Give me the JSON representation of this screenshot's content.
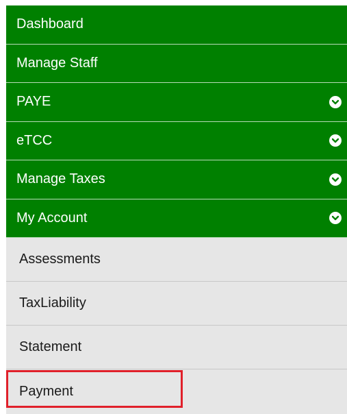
{
  "menu": {
    "items": [
      {
        "label": "Dashboard",
        "has_chevron": false,
        "icon": null
      },
      {
        "label": "Manage Staff",
        "has_chevron": false,
        "icon": null
      },
      {
        "label": "PAYE",
        "has_chevron": true,
        "icon": "chevron-down-circle-icon"
      },
      {
        "label": "eTCC",
        "has_chevron": true,
        "icon": "chevron-down-circle-icon"
      },
      {
        "label": "Manage Taxes",
        "has_chevron": true,
        "icon": "chevron-down-circle-icon"
      },
      {
        "label": "My Account",
        "has_chevron": true,
        "icon": "chevron-down-circle-icon"
      }
    ],
    "submenu": [
      {
        "label": "Assessments"
      },
      {
        "label": "TaxLiability"
      },
      {
        "label": "Statement"
      },
      {
        "label": "Payment"
      }
    ]
  },
  "colors": {
    "primary_green": "#008000",
    "submenu_bg": "#e6e6e6",
    "highlight_red": "#e0202a"
  }
}
